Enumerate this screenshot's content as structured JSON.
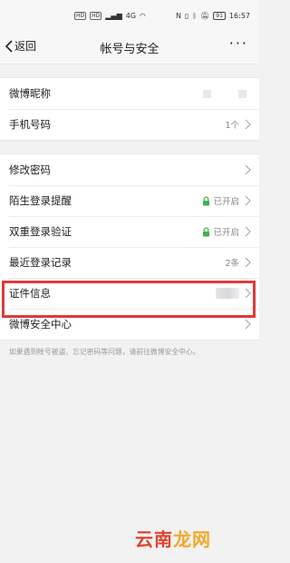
{
  "status_bar": {
    "left_chips": [
      "HD",
      "HD"
    ],
    "signal_label": "4G",
    "time": "16:57",
    "battery": "91"
  },
  "nav": {
    "back_label": "返回",
    "title": "帐号与安全",
    "more": "···"
  },
  "group1": [
    {
      "label": "微博昵称",
      "value": ""
    },
    {
      "label": "手机号码",
      "value": "1个"
    }
  ],
  "group2": [
    {
      "label": "修改密码",
      "value": ""
    },
    {
      "label": "陌生登录提醒",
      "value": "已开启",
      "lock": true
    },
    {
      "label": "双重登录验证",
      "value": "已开启",
      "lock": true
    },
    {
      "label": "最近登录记录",
      "value": "2条"
    },
    {
      "label": "证件信息",
      "value": ""
    },
    {
      "label": "微博安全中心",
      "value": ""
    }
  ],
  "footnote": "如果遇到帐号被盗、忘记密码等问题，请前往微博安全中心。",
  "watermark": {
    "part1": "云南",
    "part2": "龙网"
  },
  "colors": {
    "lock_green": "#3cb34a",
    "highlight": "#e03a3a"
  }
}
